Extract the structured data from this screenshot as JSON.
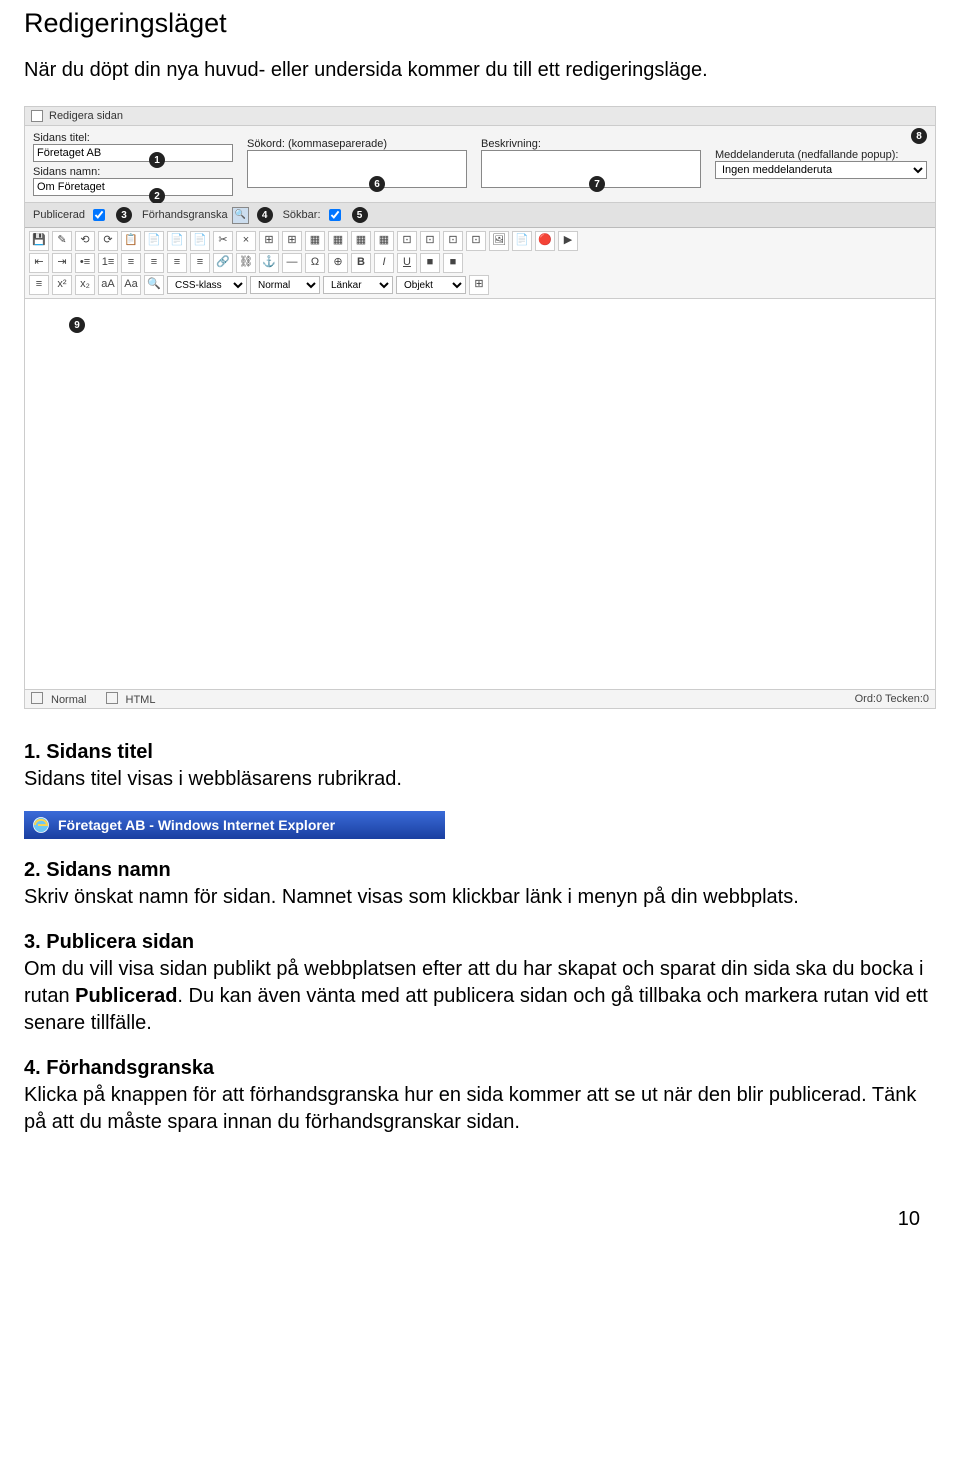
{
  "heading": "Redigeringsläget",
  "intro": "När du döpt din nya huvud- eller undersida kommer du till ett redigeringsläge.",
  "editor_panel": {
    "title": "Redigera sidan",
    "labels": {
      "sidans_titel": "Sidans titel:",
      "sokord": "Sökord: (kommaseparerade)",
      "beskrivning": "Beskrivning:",
      "meddelanderuta": "Meddelanderuta (nedfallande popup):",
      "sidans_namn": "Sidans namn:"
    },
    "values": {
      "sidans_titel": "Företaget AB",
      "sidans_namn": "Om Företaget",
      "meddelanderuta": "Ingen meddelanderuta"
    },
    "pubrow": {
      "publicerad": "Publicerad",
      "forhandsgranska": "Förhandsgranska",
      "sokbar": "Sökbar:"
    },
    "dropdowns": {
      "css": "CSS-klass",
      "format": "Normal",
      "links": "Länkar",
      "objekt": "Objekt"
    },
    "status": {
      "normal": "Normal",
      "html": "HTML",
      "counts": "Ord:0 Tecken:0"
    },
    "badges": [
      "1",
      "2",
      "3",
      "4",
      "5",
      "6",
      "7",
      "8",
      "9"
    ]
  },
  "sections": [
    {
      "title": "1. Sidans titel",
      "body": "Sidans titel visas i webbläsarens rubrikrad."
    },
    {
      "title": "2. Sidans namn",
      "body": "Skriv önskat namn för sidan. Namnet visas som klickbar länk i menyn på din webbplats."
    },
    {
      "title": "3. Publicera sidan",
      "body_before": "Om du vill visa sidan publikt på webbplatsen efter att du har skapat och sparat din sida ska du bocka i rutan ",
      "bold_word": "Publicerad",
      "body_after": ". Du kan även vänta med att publicera sidan och gå tillbaka och markera rutan vid ett senare tillfälle."
    },
    {
      "title": "4. Förhandsgranska",
      "body": "Klicka på knappen för att förhandsgranska hur en sida kommer att se ut när den blir publicerad. Tänk på att du måste spara innan du förhandsgranskar sidan."
    }
  ],
  "ie_title": "Företaget AB - Windows Internet Explorer",
  "page_number": "10"
}
